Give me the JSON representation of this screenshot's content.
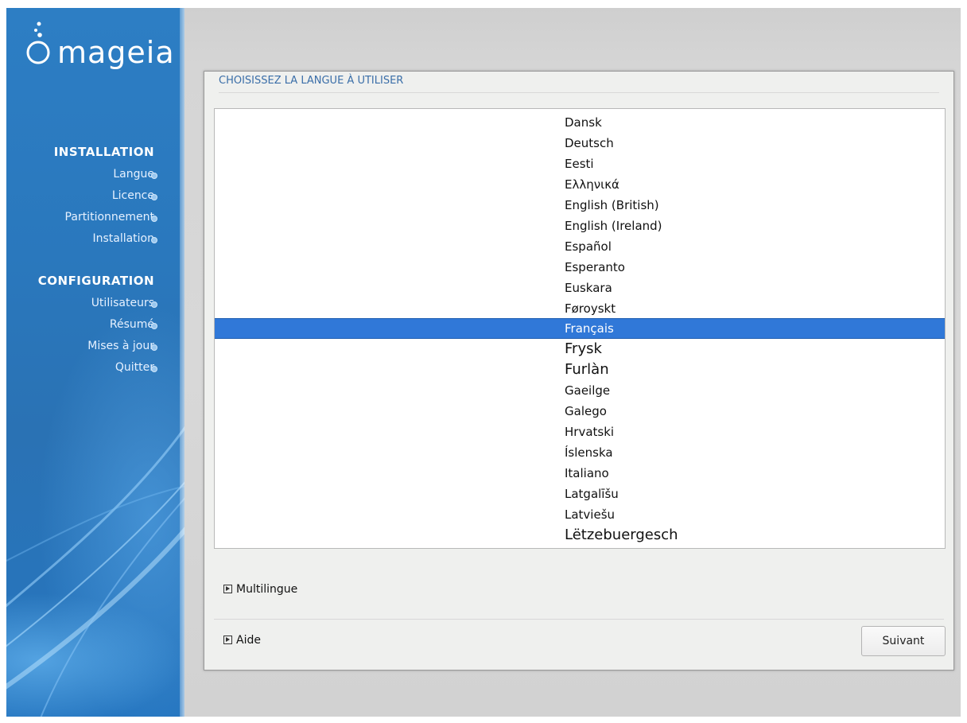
{
  "sidebar": {
    "logo_text": "mageia",
    "sections": [
      {
        "title": "INSTALLATION",
        "items": [
          "Langue",
          "Licence",
          "Partitionnement",
          "Installation"
        ]
      },
      {
        "title": "CONFIGURATION",
        "items": [
          "Utilisateurs",
          "Résumé",
          "Mises à jour",
          "Quitter"
        ]
      }
    ]
  },
  "dialog": {
    "title": "CHOISISSEZ LA LANGUE À UTILISER",
    "languages": [
      "Dansk",
      "Deutsch",
      "Eesti",
      "Ελληνικά",
      "English (British)",
      "English (Ireland)",
      "Español",
      "Esperanto",
      "Euskara",
      "Føroyskt",
      "Français",
      "Frysk",
      "Furlàn",
      "Gaeilge",
      "Galego",
      "Hrvatski",
      "Íslenska",
      "Italiano",
      "Latgalīšu",
      "Latviešu",
      "Lëtzebuergesch"
    ],
    "selected_language": "Français",
    "multilingual_label": "Multilingue",
    "help_label": "Aide",
    "next_button": "Suivant"
  },
  "colors": {
    "sidebar_blue": "#2a78bd",
    "selection_blue": "#3078d8",
    "title_blue": "#3a6ea8"
  }
}
